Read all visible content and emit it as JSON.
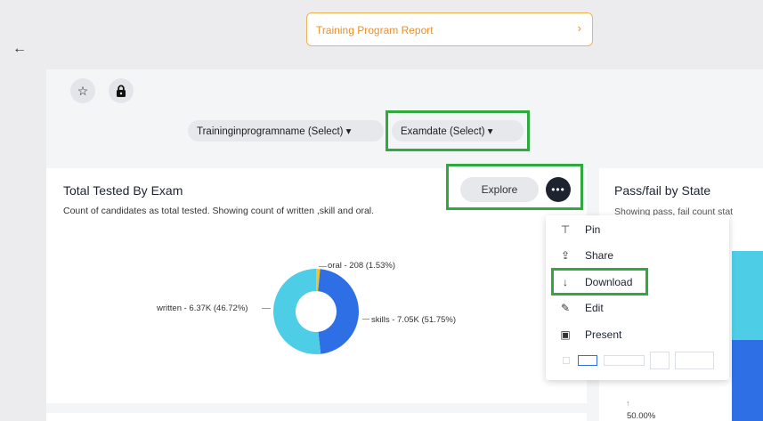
{
  "header": {
    "back_icon": "arrow-left-icon",
    "report_title": "Training Program Report",
    "report_chevron": "›"
  },
  "toolbar": {
    "star_icon": "☆",
    "lock_icon": "🔒"
  },
  "filters": [
    {
      "label": "Traininginprogramname (Select) ▾"
    },
    {
      "label": "Examdate (Select) ▾"
    }
  ],
  "card_total_tested": {
    "title": "Total Tested By Exam",
    "subtitle": "Count of candidates as total tested. Showing count of written ,skill and oral.",
    "explore_label": "Explore",
    "more_label": "•••",
    "labels": {
      "oral": "oral - 208 (1.53%)",
      "written": "written - 6.37K (46.72%)",
      "skills": "skills - 7.05K (51.75%)"
    }
  },
  "chart_data": {
    "type": "pie",
    "title": "Total Tested By Exam",
    "categories": [
      "oral",
      "written",
      "skills"
    ],
    "values": [
      208,
      6370,
      7050
    ],
    "percent": [
      1.53,
      46.72,
      51.75
    ],
    "colors": [
      "#f1c232",
      "#2f6fe6",
      "#4ecde6"
    ],
    "donut": true
  },
  "card_pass_fail": {
    "title": "Pass/fail by State",
    "subtitle": "Showing pass, fail count stat",
    "tick_mark": "↑",
    "pct_label": "50.00%",
    "colors": {
      "teal": "#4ecde6",
      "blue": "#2f6fe6"
    }
  },
  "menu": {
    "items": [
      {
        "icon": "pin-icon",
        "glyph": "⊤",
        "label": "Pin"
      },
      {
        "icon": "share-icon",
        "glyph": "⇪",
        "label": "Share"
      },
      {
        "icon": "download-icon",
        "glyph": "↓",
        "label": "Download"
      },
      {
        "icon": "edit-icon",
        "glyph": "✎",
        "label": "Edit"
      },
      {
        "icon": "present-icon",
        "glyph": "▣",
        "label": "Present"
      }
    ]
  },
  "highlight_color": "#2eaa3f"
}
